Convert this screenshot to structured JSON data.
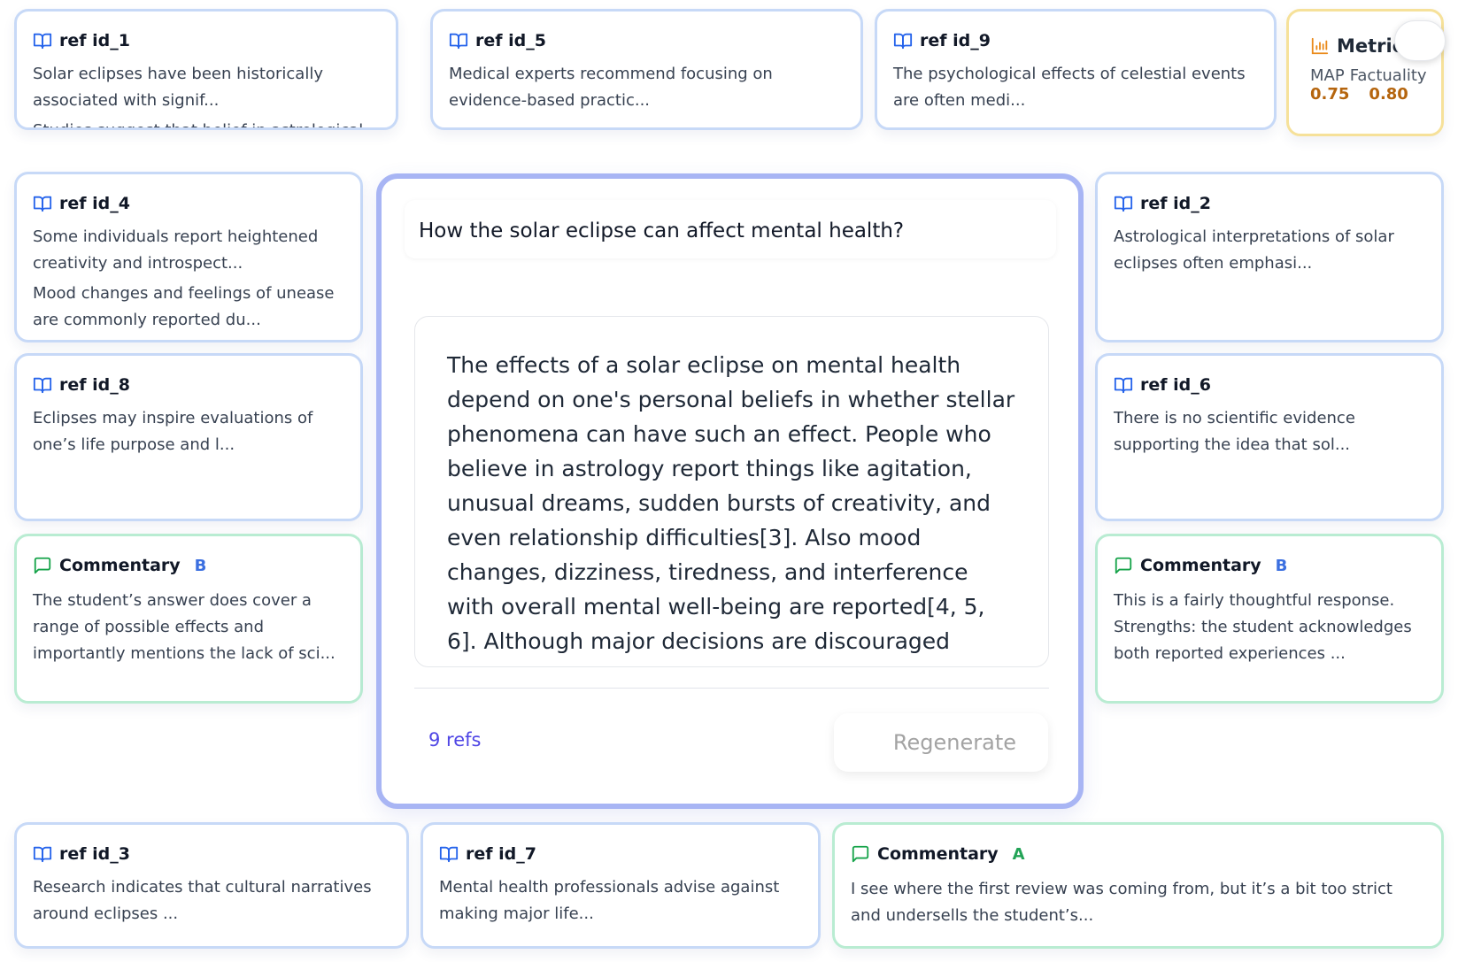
{
  "refs": {
    "id_1": {
      "title": "ref id_1",
      "texts": [
        "Solar eclipses have been historically associated with signif...",
        "Studies suggest that belief in astrological"
      ]
    },
    "id_5": {
      "title": "ref id_5",
      "texts": [
        "Medical experts recommend focusing on evidence-based practic..."
      ]
    },
    "id_9": {
      "title": "ref id_9",
      "texts": [
        "The psychological effects of celestial events are often medi..."
      ]
    },
    "id_4": {
      "title": "ref id_4",
      "texts": [
        "Some individuals report heightened creativity and introspect...",
        "Mood changes and feelings of unease are commonly reported du..."
      ]
    },
    "id_2": {
      "title": "ref id_2",
      "texts": [
        "Astrological interpretations of solar eclipses often emphasi..."
      ]
    },
    "id_8": {
      "title": "ref id_8",
      "texts": [
        "Eclipses may inspire evaluations of one’s life purpose and l..."
      ]
    },
    "id_6": {
      "title": "ref id_6",
      "texts": [
        "There is no scientific evidence supporting the idea that sol..."
      ]
    },
    "id_3": {
      "title": "ref id_3",
      "texts": [
        "Research indicates that cultural narratives around eclipses ..."
      ]
    },
    "id_7": {
      "title": "ref id_7",
      "texts": [
        "Mental health professionals advise against making major life..."
      ]
    }
  },
  "metrics": {
    "title": "Metric",
    "labels": [
      "MAP",
      "Factuality"
    ],
    "values": [
      "0.75",
      "0.80"
    ]
  },
  "commentaries": {
    "left": {
      "title": "Commentary",
      "badge": "B",
      "text": "The student’s answer does cover a range of possible effects and importantly mentions the lack of sci..."
    },
    "right": {
      "title": "Commentary",
      "badge": "B",
      "text": "This is a fairly thoughtful response. Strengths: the student acknowledges both reported experiences ..."
    },
    "bottom": {
      "title": "Commentary",
      "badge": "A",
      "text": "I see where the first review was coming from, but it’s a bit too strict and undersells the student’s..."
    }
  },
  "main": {
    "question": "How the solar eclipse can affect mental health?",
    "answer": "The effects of a solar eclipse on mental health depend on one's personal beliefs in whether stellar phenomena can have such an effect. People who believe in astrology report things like agitation, unusual dreams, sudden bursts of creativity, and even relationship difficulties[3]. Also mood changes, dizziness, tiredness, and interference with overall mental well-being are reported[4, 5, 6]. Although major decisions are discouraged during this time, eclipse are said to also foster creativity and self-expression,",
    "refs_label": "9 refs",
    "regenerate_label": "Regenerate"
  },
  "colors": {
    "ref_border": "#c7d9f7",
    "comment_border": "#b9ecd2",
    "metric_border": "#f6e19a",
    "main_border": "#a8b5f4",
    "ref_icon": "#2563eb",
    "comment_icon": "#16a34a",
    "metric_icon": "#ea8a1a"
  },
  "icons": {
    "ref": "book-open-icon",
    "commentary": "message-square-icon",
    "metrics": "bar-chart-icon"
  }
}
